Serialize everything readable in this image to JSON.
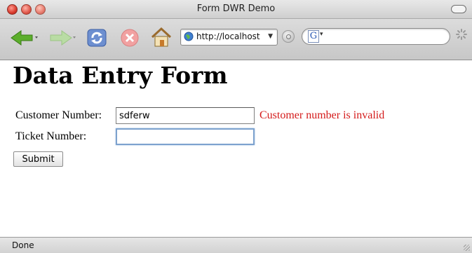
{
  "window": {
    "title": "Form DWR Demo"
  },
  "toolbar": {
    "url": "http://localhost",
    "search_engine_logo": "G",
    "icons": [
      "back-arrow-icon",
      "forward-arrow-icon",
      "reload-icon",
      "stop-icon",
      "home-icon",
      "globe-icon",
      "rss-icon",
      "google-search-icon",
      "spinner-icon"
    ]
  },
  "page": {
    "heading": "Data Entry Form",
    "customer_label": "Customer Number:",
    "customer_value": "sdferw",
    "customer_error": "Customer number is invalid",
    "ticket_label": "Ticket Number:",
    "ticket_value": "",
    "submit_label": "Submit"
  },
  "status": {
    "text": "Done"
  },
  "colors": {
    "error": "#d41a1a",
    "focus_ring": "#7da2ce"
  }
}
